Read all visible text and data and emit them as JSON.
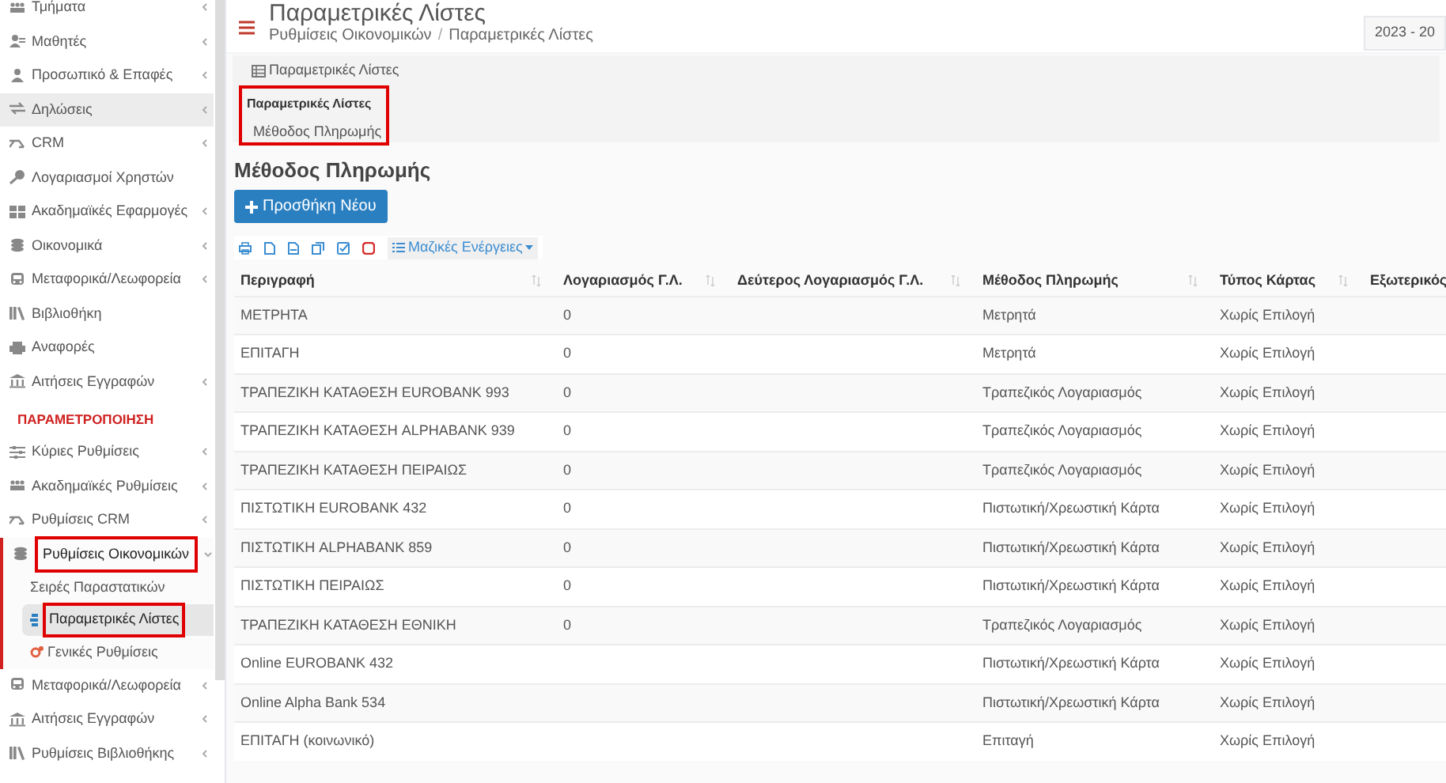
{
  "sidebar": {
    "items": [
      {
        "kind": "item",
        "label": "Τμήματα",
        "has_submenu": true,
        "selected": false
      },
      {
        "kind": "item",
        "label": "Μαθητές",
        "has_submenu": true,
        "selected": false
      },
      {
        "kind": "item",
        "label": "Προσωπικό & Επαφές",
        "has_submenu": true,
        "selected": false
      },
      {
        "kind": "item",
        "label": "Δηλώσεις",
        "has_submenu": true,
        "selected": true
      },
      {
        "kind": "item",
        "label": "CRM",
        "has_submenu": true,
        "selected": false
      },
      {
        "kind": "item",
        "label": "Λογαριασμοί Χρηστών",
        "has_submenu": false,
        "selected": false
      },
      {
        "kind": "item",
        "label": "Ακαδημαϊκές Εφαρμογές",
        "has_submenu": true,
        "selected": false
      },
      {
        "kind": "item",
        "label": "Οικονομικά",
        "has_submenu": true,
        "selected": false
      },
      {
        "kind": "item",
        "label": "Μεταφορικά/Λεωφορεία",
        "has_submenu": true,
        "selected": false
      },
      {
        "kind": "item",
        "label": "Βιβλιοθήκη",
        "has_submenu": false,
        "selected": false
      },
      {
        "kind": "item",
        "label": "Αναφορές",
        "has_submenu": false,
        "selected": false
      },
      {
        "kind": "item",
        "label": "Αιτήσεις Εγγραφών",
        "has_submenu": true,
        "selected": false
      },
      {
        "kind": "header",
        "label": "ΠΑΡΑΜΕΤΡΟΠΟΙΗΣΗ"
      },
      {
        "kind": "item",
        "label": "Κύριες Ρυθμίσεις",
        "has_submenu": true,
        "selected": false
      },
      {
        "kind": "item",
        "label": "Ακαδημαϊκές Ρυθμίσεις",
        "has_submenu": true,
        "selected": false
      },
      {
        "kind": "item",
        "label": "Ρυθμίσεις CRM",
        "has_submenu": true,
        "selected": false
      },
      {
        "kind": "item",
        "label": "Ρυθμίσεις Οικονομικών",
        "has_submenu": true,
        "selected": false,
        "expanded": true,
        "highlighted": true,
        "children": [
          {
            "label": "Σειρές Παραστατικών",
            "selected": false,
            "highlighted": false
          },
          {
            "label": "Παραμετρικές Λίστες",
            "selected": true,
            "highlighted": true
          },
          {
            "label": "Γενικές Ρυθμίσεις",
            "selected": false,
            "highlighted": false
          }
        ]
      },
      {
        "kind": "item",
        "label": "Μεταφορικά/Λεωφορεία",
        "has_submenu": true,
        "selected": false
      },
      {
        "kind": "item",
        "label": "Αιτήσεις Εγγραφών",
        "has_submenu": true,
        "selected": false
      },
      {
        "kind": "item",
        "label": "Ρυθμίσεις Βιβλιοθήκης",
        "has_submenu": true,
        "selected": false
      }
    ]
  },
  "header": {
    "title": "Παραμετρικές Λίστες",
    "breadcrumb": [
      "Ρυθμίσεις Οικονομικών",
      "/",
      "Παραμετρικές Λίστες"
    ],
    "year": "2023 - 20"
  },
  "panel": {
    "tab": "Παραμετρικές Λίστες",
    "label": "Παραμετρικές Λίστες",
    "option": "Μέθοδος Πληρωμής",
    "highlighted": true
  },
  "section_title": "Μέθοδος Πληρωμής",
  "add_button": "Προσθήκη Νέου",
  "bulk_actions": "Μαζικές Ενέργειες",
  "table": {
    "columns": [
      "Περιγραφή",
      "Λογαριασμός Γ.Λ.",
      "Δεύτερος Λογαριασμός Γ.Λ.",
      "Μέθοδος Πληρωμής",
      "Τύπος Κάρτας",
      "Εξωτερικός"
    ],
    "rows": [
      [
        "ΜΕΤΡΗΤΑ",
        "0",
        "",
        "Μετρητά",
        "Χωρίς Επιλογή"
      ],
      [
        "ΕΠΙΤΑΓΗ",
        "0",
        "",
        "Μετρητά",
        "Χωρίς Επιλογή"
      ],
      [
        "ΤΡΑΠΕΖΙΚΗ ΚΑΤΑΘΕΣΗ EUROBANK 993",
        "0",
        "",
        "Τραπεζικός Λογαριασμός",
        "Χωρίς Επιλογή"
      ],
      [
        "ΤΡΑΠΕΖΙΚΗ ΚΑΤΑΘΕΣΗ ALPHABANK 939",
        "0",
        "",
        "Τραπεζικός Λογαριασμός",
        "Χωρίς Επιλογή"
      ],
      [
        "ΤΡΑΠΕΖΙΚΗ ΚΑΤΑΘΕΣΗ ΠΕΙΡΑΙΩΣ",
        "0",
        "",
        "Τραπεζικός Λογαριασμός",
        "Χωρίς Επιλογή"
      ],
      [
        "ΠΙΣΤΩΤΙΚΗ EUROBANK 432",
        "0",
        "",
        "Πιστωτική/Χρεωστική Κάρτα",
        "Χωρίς Επιλογή"
      ],
      [
        "ΠΙΣΤΩΤΙΚΗ ALPHABANK 859",
        "0",
        "",
        "Πιστωτική/Χρεωστική Κάρτα",
        "Χωρίς Επιλογή"
      ],
      [
        "ΠΙΣΤΩΤΙΚΗ ΠΕΙΡΑΙΩΣ",
        "0",
        "",
        "Πιστωτική/Χρεωστική Κάρτα",
        "Χωρίς Επιλογή"
      ],
      [
        "ΤΡΑΠΕΖΙΚΗ ΚΑΤΑΘΕΣΗ ΕΘΝΙΚΗ",
        "0",
        "",
        "Τραπεζικός Λογαριασμός",
        "Χωρίς Επιλογή"
      ],
      [
        "Online EUROBANK 432",
        "",
        "",
        "Πιστωτική/Χρεωστική Κάρτα",
        "Χωρίς Επιλογή"
      ],
      [
        "Online Alpha Bank 534",
        "",
        "",
        "Πιστωτική/Χρεωστική Κάρτα",
        "Χωρίς Επιλογή"
      ],
      [
        "ΕΠΙΤΑΓΗ (κοινωνικό)",
        "",
        "",
        "Επιταγή",
        "Χωρίς Επιλογή"
      ]
    ]
  }
}
